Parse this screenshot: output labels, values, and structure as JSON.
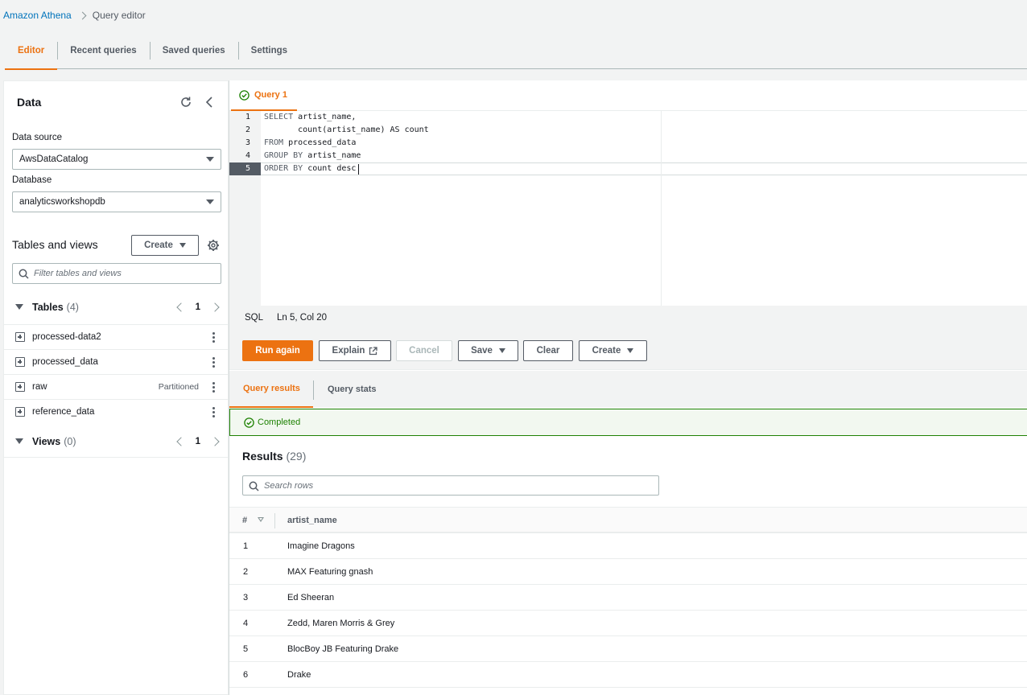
{
  "breadcrumb": {
    "root": "Amazon Athena",
    "current": "Query editor"
  },
  "top_tabs": [
    "Editor",
    "Recent queries",
    "Saved queries",
    "Settings"
  ],
  "data_panel": {
    "title": "Data",
    "data_source_label": "Data source",
    "data_source_value": "AwsDataCatalog",
    "database_label": "Database",
    "database_value": "analyticsworkshopdb",
    "tables_views_title": "Tables and views",
    "create_label": "Create",
    "filter_placeholder": "Filter tables and views",
    "tables_label": "Tables",
    "tables_count": "(4)",
    "tables_page": "1",
    "tables": [
      {
        "name": "processed-data2",
        "badge": ""
      },
      {
        "name": "processed_data",
        "badge": ""
      },
      {
        "name": "raw",
        "badge": "Partitioned"
      },
      {
        "name": "reference_data",
        "badge": ""
      }
    ],
    "views_label": "Views",
    "views_count": "(0)",
    "views_page": "1"
  },
  "query_tab": {
    "label": "Query 1"
  },
  "editor": {
    "line_numbers": [
      "1",
      "2",
      "3",
      "4",
      "5"
    ],
    "lines": [
      {
        "kw": "SELECT",
        "rest": " artist_name,"
      },
      {
        "kw": "",
        "rest": "       count(artist_name) AS count"
      },
      {
        "kw": "FROM",
        "rest": " processed_data"
      },
      {
        "kw": "GROUP BY",
        "rest": " artist_name"
      },
      {
        "kw": "ORDER BY",
        "rest": " count desc"
      }
    ],
    "language": "SQL",
    "cursor_position": "Ln 5, Col 20"
  },
  "actions": {
    "run_again": "Run again",
    "explain": "Explain",
    "cancel": "Cancel",
    "save": "Save",
    "clear": "Clear",
    "create": "Create"
  },
  "result_tabs": {
    "results": "Query results",
    "stats": "Query stats"
  },
  "status": "Completed",
  "results": {
    "title": "Results",
    "count": "(29)",
    "search_placeholder": "Search rows",
    "col_hash": "#",
    "col_name": "artist_name",
    "rows": [
      {
        "n": "1",
        "artist_name": "Imagine Dragons"
      },
      {
        "n": "2",
        "artist_name": "MAX Featuring gnash"
      },
      {
        "n": "3",
        "artist_name": "Ed Sheeran"
      },
      {
        "n": "4",
        "artist_name": "Zedd, Maren Morris & Grey"
      },
      {
        "n": "5",
        "artist_name": "BlocBoy JB Featuring Drake"
      },
      {
        "n": "6",
        "artist_name": "Drake"
      }
    ]
  },
  "colors": {
    "accent": "#ec7211",
    "link": "#0073bb",
    "success": "#1d8102"
  }
}
